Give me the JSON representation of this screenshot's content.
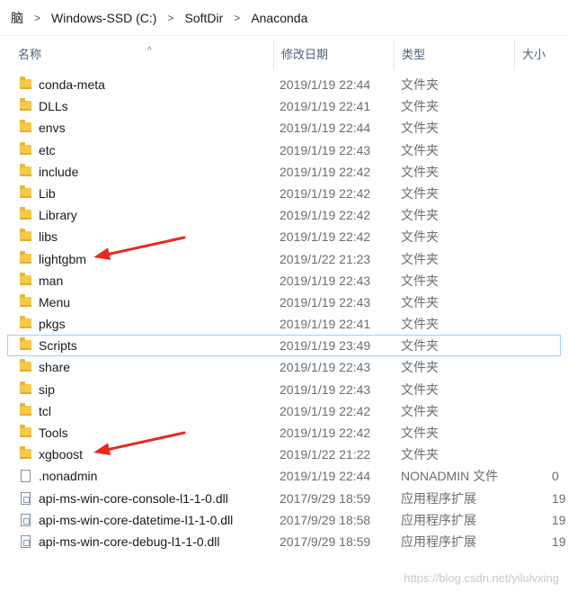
{
  "breadcrumb": {
    "items": [
      "脑",
      "Windows-SSD (C:)",
      "SoftDir",
      "Anaconda"
    ]
  },
  "columns": {
    "name": "名称",
    "date": "修改日期",
    "type": "类型",
    "size": "大小"
  },
  "files": [
    {
      "name": "conda-meta",
      "date": "2019/1/19 22:44",
      "type": "文件夹",
      "size": "",
      "icon": "folder-icon"
    },
    {
      "name": "DLLs",
      "date": "2019/1/19 22:41",
      "type": "文件夹",
      "size": "",
      "icon": "folder-icon"
    },
    {
      "name": "envs",
      "date": "2019/1/19 22:44",
      "type": "文件夹",
      "size": "",
      "icon": "folder-icon"
    },
    {
      "name": "etc",
      "date": "2019/1/19 22:43",
      "type": "文件夹",
      "size": "",
      "icon": "folder-icon"
    },
    {
      "name": "include",
      "date": "2019/1/19 22:42",
      "type": "文件夹",
      "size": "",
      "icon": "folder-icon"
    },
    {
      "name": "Lib",
      "date": "2019/1/19 22:42",
      "type": "文件夹",
      "size": "",
      "icon": "folder-icon"
    },
    {
      "name": "Library",
      "date": "2019/1/19 22:42",
      "type": "文件夹",
      "size": "",
      "icon": "folder-icon"
    },
    {
      "name": "libs",
      "date": "2019/1/19 22:42",
      "type": "文件夹",
      "size": "",
      "icon": "folder-icon"
    },
    {
      "name": "lightgbm",
      "date": "2019/1/22 21:23",
      "type": "文件夹",
      "size": "",
      "icon": "folder-icon"
    },
    {
      "name": "man",
      "date": "2019/1/19 22:43",
      "type": "文件夹",
      "size": "",
      "icon": "folder-icon"
    },
    {
      "name": "Menu",
      "date": "2019/1/19 22:43",
      "type": "文件夹",
      "size": "",
      "icon": "folder-icon"
    },
    {
      "name": "pkgs",
      "date": "2019/1/19 22:41",
      "type": "文件夹",
      "size": "",
      "icon": "folder-icon"
    },
    {
      "name": "Scripts",
      "date": "2019/1/19 23:49",
      "type": "文件夹",
      "size": "",
      "icon": "folder-icon",
      "selected": true
    },
    {
      "name": "share",
      "date": "2019/1/19 22:43",
      "type": "文件夹",
      "size": "",
      "icon": "folder-icon"
    },
    {
      "name": "sip",
      "date": "2019/1/19 22:43",
      "type": "文件夹",
      "size": "",
      "icon": "folder-icon"
    },
    {
      "name": "tcl",
      "date": "2019/1/19 22:42",
      "type": "文件夹",
      "size": "",
      "icon": "folder-icon"
    },
    {
      "name": "Tools",
      "date": "2019/1/19 22:42",
      "type": "文件夹",
      "size": "",
      "icon": "folder-icon"
    },
    {
      "name": "xgboost",
      "date": "2019/1/22 21:22",
      "type": "文件夹",
      "size": "",
      "icon": "folder-icon"
    },
    {
      "name": ".nonadmin",
      "date": "2019/1/19 22:44",
      "type": "NONADMIN 文件",
      "size": "0",
      "icon": "file-icon"
    },
    {
      "name": "api-ms-win-core-console-l1-1-0.dll",
      "date": "2017/9/29 18:59",
      "type": "应用程序扩展",
      "size": "19",
      "icon": "dll-file-icon"
    },
    {
      "name": "api-ms-win-core-datetime-l1-1-0.dll",
      "date": "2017/9/29 18:58",
      "type": "应用程序扩展",
      "size": "19",
      "icon": "dll-file-icon"
    },
    {
      "name": "api-ms-win-core-debug-l1-1-0.dll",
      "date": "2017/9/29 18:59",
      "type": "应用程序扩展",
      "size": "19",
      "icon": "dll-file-icon"
    }
  ],
  "annotations": {
    "arrow_color": "#e8291f",
    "arrow_targets": [
      "lightgbm",
      "xgboost"
    ]
  },
  "watermark": "https://blog.csdn.net/yilulvxing",
  "colors": {
    "selection_border": "#99d1ff",
    "header_text": "#4c607a",
    "secondary_text": "#6d6d6d"
  }
}
